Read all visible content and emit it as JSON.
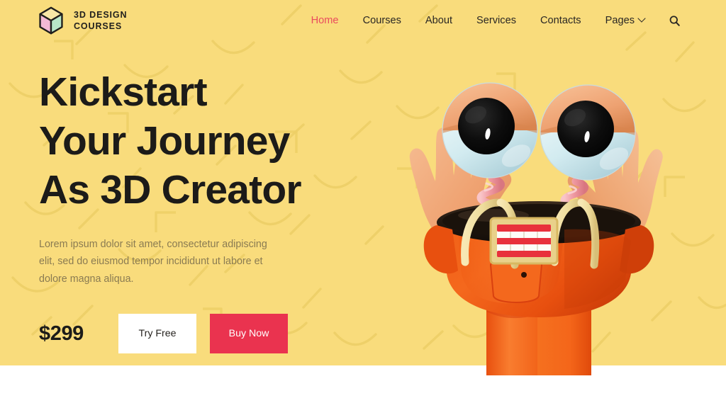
{
  "page": {
    "background_color": "#f9dc7c",
    "footer_strip_color": "#ffffff"
  },
  "header": {
    "brand": {
      "logo_icon": "cube-icon",
      "name": "3D DESIGN\nCOURSES",
      "cube_colors": {
        "top": "#f7e7a6",
        "left": "#f3b9d4",
        "right": "#b8e6c8",
        "outline": "#201f1d"
      }
    },
    "nav": [
      {
        "label": "Home",
        "active": true
      },
      {
        "label": "Courses",
        "active": false
      },
      {
        "label": "About",
        "active": false
      },
      {
        "label": "Services",
        "active": false
      },
      {
        "label": "Contacts",
        "active": false
      },
      {
        "label": "Pages",
        "active": false,
        "has_dropdown": true,
        "dropdown_icon": "chevron-down-icon"
      }
    ],
    "search_icon": "search-icon",
    "active_color": "#ea4b5e",
    "link_color": "#2a2724"
  },
  "hero": {
    "title": "Kickstart\nYour Journey\nAs 3D Creator",
    "subtitle": "Lorem ipsum dolor sit amet, consectetur adipiscing elit, sed do eiusmod tempor incididunt ut labore et dolore magna aliqua.",
    "price": "$299",
    "primary_button": "Buy Now",
    "secondary_button": "Try Free",
    "primary_button_color": "#ea334f",
    "secondary_button_color": "#ffffff",
    "title_color": "#1c1b19",
    "subtitle_color": "#8a7b52"
  },
  "illustration": {
    "name": "3d-robot-character",
    "description": "Orange 3D robot with two spring-mounted eyeballs raising both hands",
    "colors": {
      "body": "#f4601a",
      "body_shadow": "#d9410f",
      "skin": "#f0a878",
      "eye_white": "#d7eef1",
      "eye_cap": "#f0a878",
      "pupil": "#0b0b0b",
      "spring": "#f2a0a6",
      "strap": "#f2dfa0",
      "rim": "#2b2118",
      "teeth": "#fdfdf7",
      "gums": "#e8313c",
      "watch_band": "#1b1b1b",
      "watch_face": "#ffffff"
    }
  }
}
